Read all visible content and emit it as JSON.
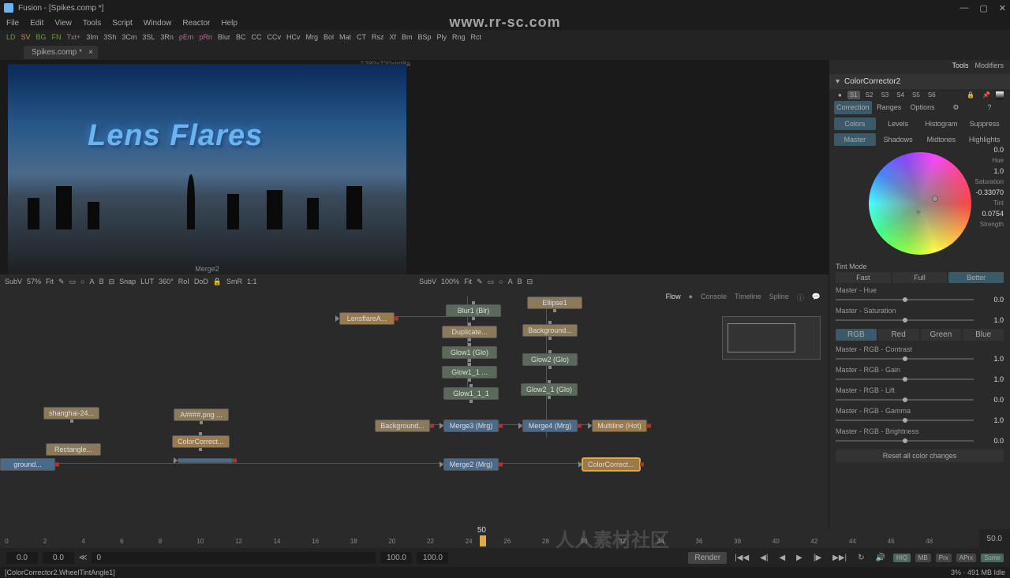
{
  "title": "Fusion - [Spikes.comp *]",
  "menubar": [
    "File",
    "Edit",
    "View",
    "Tools",
    "Script",
    "Window",
    "Reactor",
    "Help"
  ],
  "toolbar_short": [
    "LD",
    "SV",
    "BG",
    "FN",
    "Txt+",
    "3Im",
    "3Sh",
    "3Cm",
    "3SL",
    "3Rn",
    "pEm",
    "pRn",
    "Blur",
    "BC",
    "CC",
    "CCv",
    "HCv",
    "Mrg",
    "Bol",
    "Mat",
    "CT",
    "Rsz",
    "Xf",
    "Bm",
    "BSp",
    "Ply",
    "Rng",
    "Rct"
  ],
  "tab": {
    "name": "Spikes.comp *"
  },
  "viewer1": {
    "name": "SubV",
    "zoom": "57%",
    "fit": "Fit",
    "snap": "Snap",
    "lut": "LUT",
    "deg": "360°",
    "rol": "RoI",
    "dod": "DoD",
    "smr": "SmR",
    "ratio": "1:1",
    "resolution": "1280x720xint8a",
    "label": "Merge2",
    "text": "Lens Flares"
  },
  "viewer2": {
    "name": "SubV",
    "zoom": "100%",
    "fit": "Fit"
  },
  "flow": {
    "tabs": [
      "Flow",
      "Console",
      "Timeline",
      "Spline"
    ],
    "nodes": {
      "lensflare": "LensflareA...",
      "blur1": "Blur1  (Blr)",
      "duplicate": "Duplicate...",
      "glow1": "Glow1  (Glo)",
      "glow1_1": "Glow1_1  ...",
      "glow1_1_1": "Glow1_1_1",
      "ellipse1": "Ellipse1",
      "background": "Background...",
      "glow2": "Glow2  (Glo)",
      "glow2_1": "Glow2_1  (Glo)",
      "shanghai": "shanghai-24...",
      "alpha": "A####.png ...",
      "rectangle": "Rectangle...",
      "colorcorrect_l": "ColorCorrect...",
      "ground": "ground...",
      "background1": "Background...",
      "merge3": "Merge3  (Mrg)",
      "merge4": "Merge4  (Mrg)",
      "multiline": "Multiline  (Hot)",
      "merge2": "Merge2  (Mrg)",
      "colorcorrect": "ColorCorrect..."
    }
  },
  "inspector": {
    "tabs": [
      "Tools",
      "Modifiers"
    ],
    "title": "ColorCorrector2",
    "store": [
      "S1",
      "S2",
      "S3",
      "S4",
      "S5",
      "S6"
    ],
    "subtabs1": [
      "Correction",
      "Ranges",
      "Options"
    ],
    "subtabs2": [
      "Colors",
      "Levels",
      "Histogram",
      "Suppress"
    ],
    "subtabs3": [
      "Master",
      "Shadows",
      "Midtones",
      "Highlights"
    ],
    "wheel": {
      "hue": {
        "val": "0.0",
        "lbl": "Hue"
      },
      "sat": {
        "val": "1.0",
        "lbl": "Saturation"
      },
      "tint": {
        "val": "-0.33070",
        "lbl": "Tint"
      },
      "str": {
        "val": "0.0754",
        "lbl": "Strength"
      }
    },
    "tintmode": {
      "label": "Tint Mode",
      "options": [
        "Fast",
        "Full",
        "Better"
      ]
    },
    "rgbtabs": [
      "RGB",
      "Red",
      "Green",
      "Blue"
    ],
    "params": [
      {
        "label": "Master - Hue",
        "value": "0.0",
        "pos": 50
      },
      {
        "label": "Master - Saturation",
        "value": "1.0",
        "pos": 50
      },
      {
        "label": "Master - RGB - Contrast",
        "value": "1.0",
        "pos": 50
      },
      {
        "label": "Master - RGB - Gain",
        "value": "1.0",
        "pos": 50
      },
      {
        "label": "Master - RGB - Lift",
        "value": "0.0",
        "pos": 50
      },
      {
        "label": "Master - RGB - Gamma",
        "value": "1.0",
        "pos": 50
      },
      {
        "label": "Master - RGB - Brightness",
        "value": "0.0",
        "pos": 50
      }
    ],
    "reset": "Reset all color changes"
  },
  "timeline": {
    "playhead_label": "50",
    "ticks": [
      "0",
      "2",
      "4",
      "6",
      "8",
      "10",
      "12",
      "14",
      "16",
      "18",
      "20",
      "22",
      "24",
      "26",
      "28",
      "30",
      "32",
      "34",
      "36",
      "38",
      "40",
      "42",
      "44",
      "46",
      "48"
    ],
    "end": "50.0"
  },
  "transport": {
    "start": "0.0",
    "instart": "0.0",
    "cur": "0",
    "inend": "100.0",
    "end": "100.0",
    "render": "Render",
    "tags": [
      "HiQ",
      "MB",
      "Prx",
      "APrx",
      "Some"
    ]
  },
  "status": {
    "left": "[ColorCorrector2.WheelTintAngle1]",
    "right": "3% · 491 MB       Idle"
  },
  "watermark": "www.rr-sc.com",
  "watermark2": "人人素材社区"
}
